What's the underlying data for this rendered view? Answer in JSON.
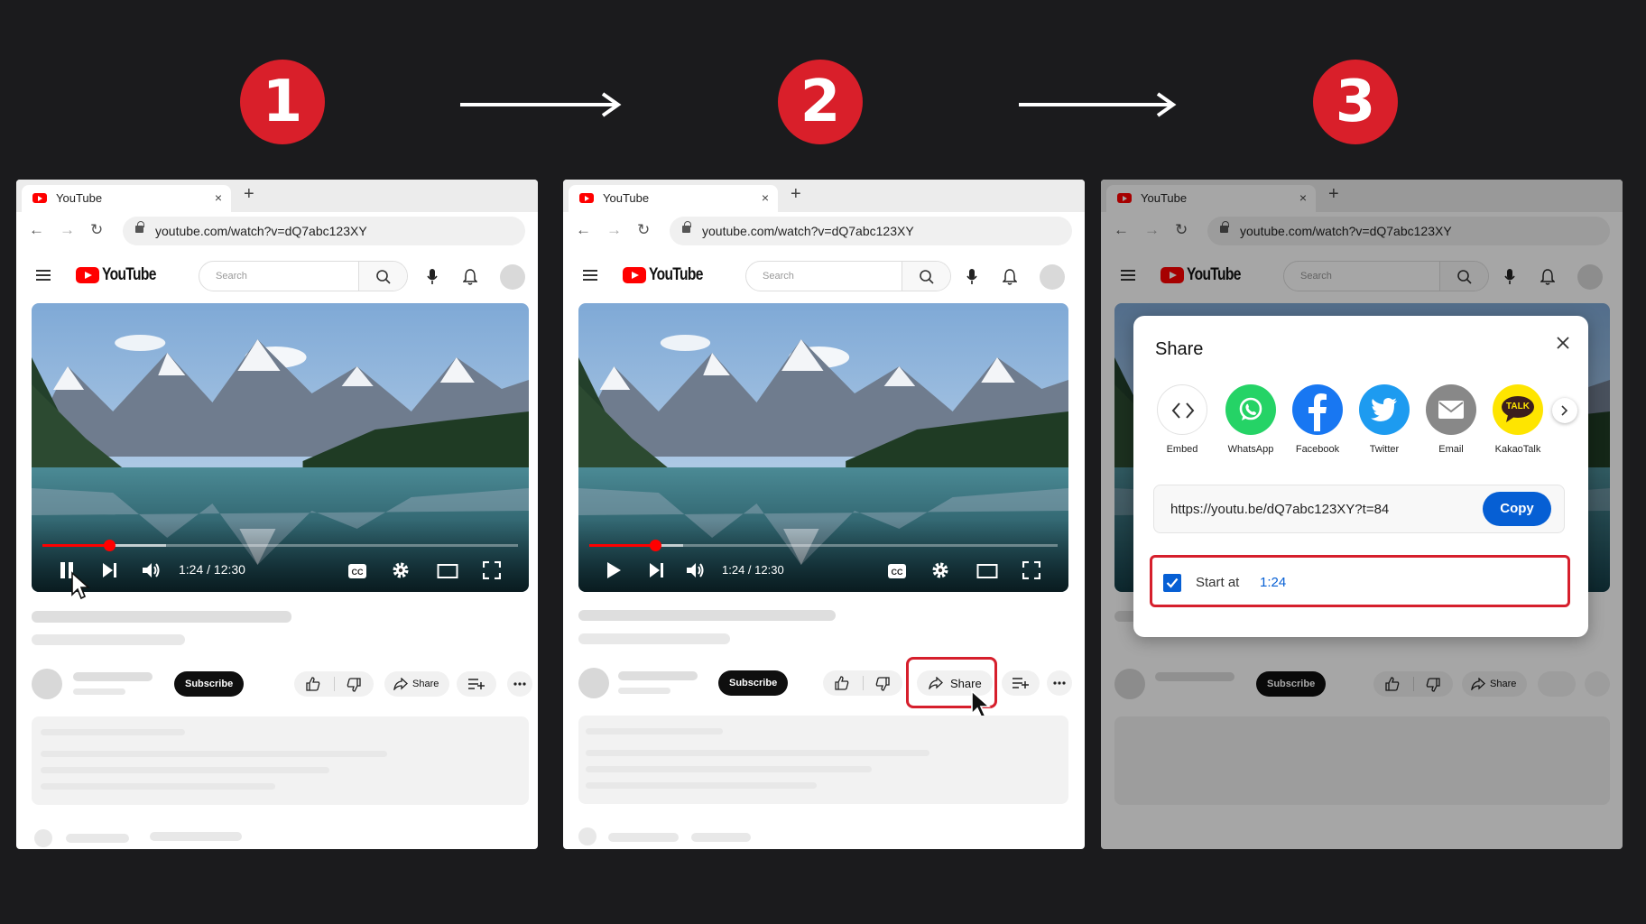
{
  "steps": [
    "1",
    "2",
    "3"
  ],
  "browser": {
    "tab_title": "YouTube",
    "tab_close": "×",
    "new_tab": "+",
    "url": "youtube.com/watch?v=dQ7abc123XY"
  },
  "youtube": {
    "logo_text": "YouTube",
    "search_placeholder": "Search",
    "time_display": "1:24 / 12:30",
    "progress_fraction": 0.14,
    "subscribe_label": "Subscribe",
    "share_label": "Share"
  },
  "share_dialog": {
    "title": "Share",
    "options": [
      {
        "label": "Embed",
        "icon": "embed-icon"
      },
      {
        "label": "WhatsApp",
        "icon": "whatsapp-icon",
        "color": "#25d366"
      },
      {
        "label": "Facebook",
        "icon": "facebook-icon",
        "color": "#1877f2"
      },
      {
        "label": "Twitter",
        "icon": "twitter-icon",
        "color": "#1d9bf0"
      },
      {
        "label": "Email",
        "icon": "email-icon",
        "color": "#888888"
      },
      {
        "label": "KakaoTalk",
        "icon": "kakaotalk-icon",
        "color": "#fee500"
      }
    ],
    "kakao_badge": "TALK",
    "link": "https://youtu.be/dQ7abc123XY?t=84",
    "copy_label": "Copy",
    "start_at_label": "Start at",
    "start_at_value": "1:24",
    "start_at_checked": true
  },
  "colors": {
    "step_badge": "#d91f2a",
    "highlight": "#d61f2c",
    "youtube_red": "#ff0000",
    "copy_button": "#065fd4"
  }
}
